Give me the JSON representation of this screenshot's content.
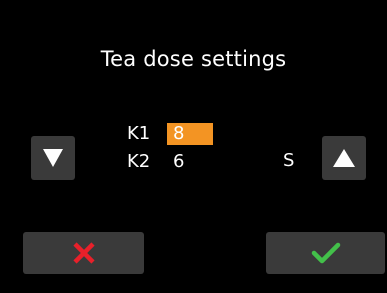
{
  "screen": {
    "title": "Tea dose settings"
  },
  "params": [
    {
      "label": "K1",
      "value": "8",
      "selected": true
    },
    {
      "label": "K2",
      "value": "6",
      "selected": false
    }
  ],
  "unit": "S",
  "buttons": {
    "decrease_icon": "triangle-down-icon",
    "increase_icon": "triangle-up-icon",
    "cancel_icon": "cross-icon",
    "confirm_icon": "checkmark-icon"
  },
  "colors": {
    "background": "#000000",
    "button": "#3a3a3a",
    "selected_highlight": "#f39423",
    "cancel": "#e8202a",
    "confirm": "#43c04a",
    "text": "#ffffff"
  }
}
